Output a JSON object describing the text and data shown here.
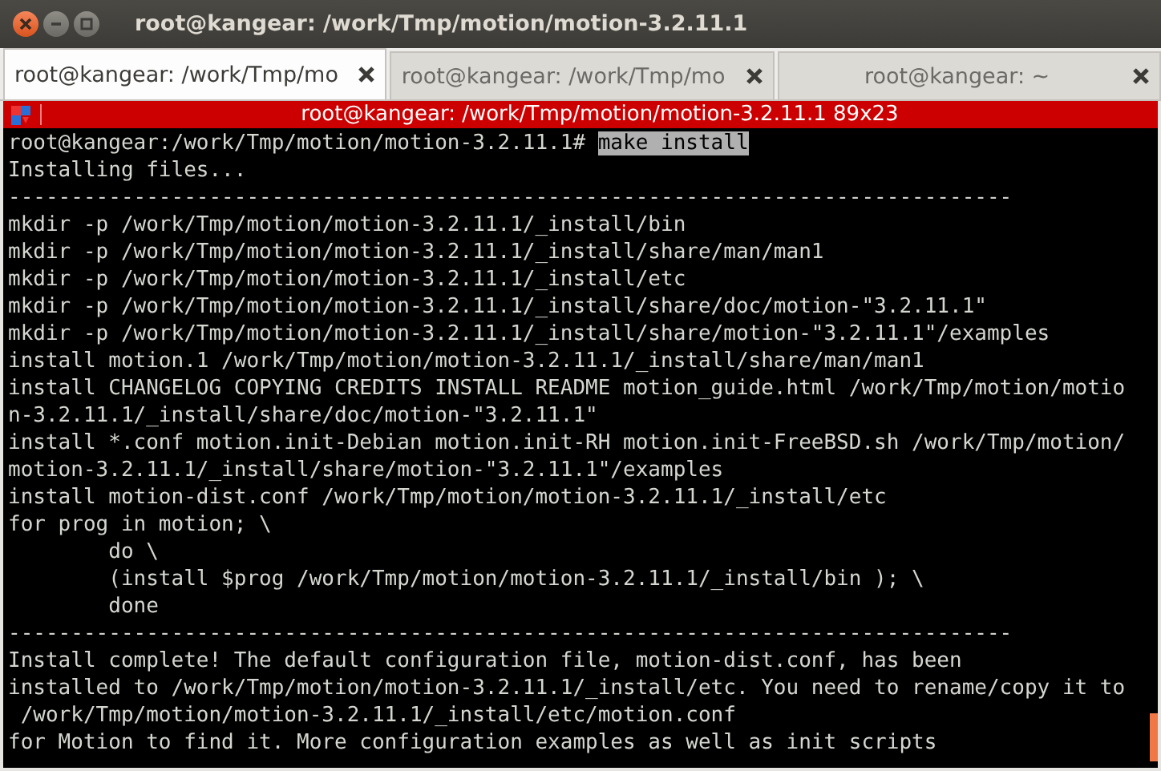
{
  "window": {
    "title": "root@kangear: /work/Tmp/motion/motion-3.2.11.1"
  },
  "tabs": [
    {
      "label": "root@kangear: /work/Tmp/mo",
      "selected": true
    },
    {
      "label": "root@kangear: /work/Tmp/mo",
      "selected": false
    },
    {
      "label": "root@kangear: ~",
      "selected": false
    }
  ],
  "terminal": {
    "title": "root@kangear: /work/Tmp/motion/motion-3.2.11.1 89x23",
    "lines": [
      {
        "kind": "prompt",
        "prompt": "root@kangear:/work/Tmp/motion/motion-3.2.11.1# ",
        "command": "make install"
      },
      {
        "kind": "output",
        "text": "Installing files..."
      },
      {
        "kind": "output",
        "text": "--------------------------------------------------------------------------------"
      },
      {
        "kind": "output",
        "text": "mkdir -p /work/Tmp/motion/motion-3.2.11.1/_install/bin"
      },
      {
        "kind": "output",
        "text": "mkdir -p /work/Tmp/motion/motion-3.2.11.1/_install/share/man/man1"
      },
      {
        "kind": "output",
        "text": "mkdir -p /work/Tmp/motion/motion-3.2.11.1/_install/etc"
      },
      {
        "kind": "output",
        "text": "mkdir -p /work/Tmp/motion/motion-3.2.11.1/_install/share/doc/motion-\"3.2.11.1\""
      },
      {
        "kind": "output",
        "text": "mkdir -p /work/Tmp/motion/motion-3.2.11.1/_install/share/motion-\"3.2.11.1\"/examples"
      },
      {
        "kind": "output",
        "text": "install motion.1 /work/Tmp/motion/motion-3.2.11.1/_install/share/man/man1"
      },
      {
        "kind": "output",
        "text": "install CHANGELOG COPYING CREDITS INSTALL README motion_guide.html /work/Tmp/motion/motio"
      },
      {
        "kind": "output",
        "text": "n-3.2.11.1/_install/share/doc/motion-\"3.2.11.1\""
      },
      {
        "kind": "output",
        "text": "install *.conf motion.init-Debian motion.init-RH motion.init-FreeBSD.sh /work/Tmp/motion/"
      },
      {
        "kind": "output",
        "text": "motion-3.2.11.1/_install/share/motion-\"3.2.11.1\"/examples"
      },
      {
        "kind": "output",
        "text": "install motion-dist.conf /work/Tmp/motion/motion-3.2.11.1/_install/etc"
      },
      {
        "kind": "output",
        "text": "for prog in motion; \\"
      },
      {
        "kind": "output",
        "text": "        do \\"
      },
      {
        "kind": "output",
        "text": "        (install $prog /work/Tmp/motion/motion-3.2.11.1/_install/bin ); \\"
      },
      {
        "kind": "output",
        "text": "        done"
      },
      {
        "kind": "output",
        "text": "--------------------------------------------------------------------------------"
      },
      {
        "kind": "output",
        "text": "Install complete! The default configuration file, motion-dist.conf, has been"
      },
      {
        "kind": "output",
        "text": "installed to /work/Tmp/motion/motion-3.2.11.1/_install/etc. You need to rename/copy it to"
      },
      {
        "kind": "output",
        "text": " /work/Tmp/motion/motion-3.2.11.1/_install/etc/motion.conf"
      },
      {
        "kind": "output",
        "text": "for Motion to find it. More configuration examples as well as init scripts"
      }
    ]
  }
}
